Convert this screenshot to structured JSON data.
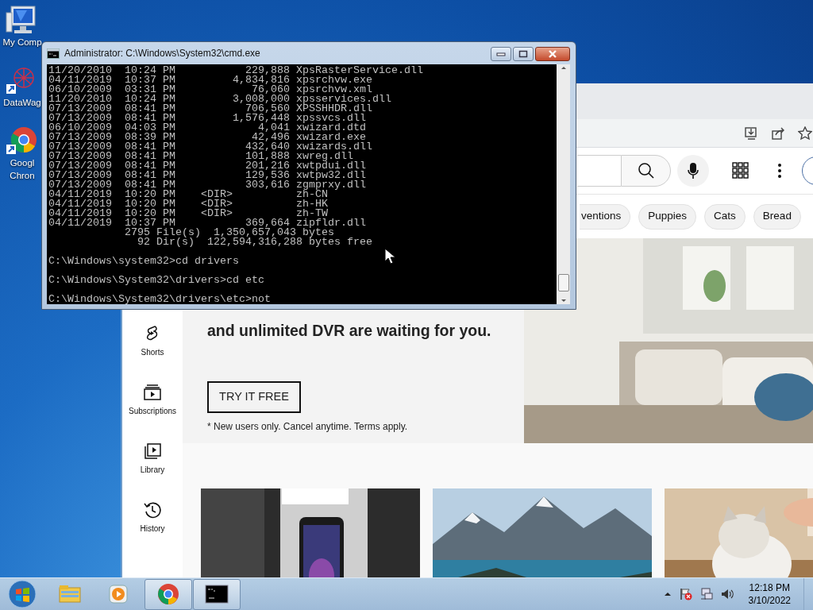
{
  "desktop_icons": [
    {
      "kind": "computer",
      "lines": [
        "My Comp"
      ]
    },
    {
      "kind": "app",
      "lines": [
        "DataWag"
      ]
    },
    {
      "kind": "browser",
      "lines": [
        "Googl",
        "Chron"
      ]
    }
  ],
  "browser": {
    "chips": [
      {
        "label": "ventions",
        "selected": false
      },
      {
        "label": "Puppies",
        "selected": false
      },
      {
        "label": "Cats",
        "selected": false
      },
      {
        "label": "Bread",
        "selected": false
      }
    ],
    "sidebar": [
      {
        "kind": "shorts",
        "label": "Shorts"
      },
      {
        "kind": "subscriptions",
        "label": "Subscriptions"
      },
      {
        "kind": "library",
        "label": "Library"
      },
      {
        "kind": "history",
        "label": "History"
      }
    ],
    "ad": {
      "heading": "and unlimited DVR are waiting for you.",
      "button": "TRY IT FREE",
      "note": "* New users only. Cancel anytime. Terms apply."
    }
  },
  "cmd": {
    "title": "Administrator: C:\\Windows\\System32\\cmd.exe",
    "lines": [
      "11/20/2010  10:24 PM           229,888 XpsRasterService.dll",
      "04/11/2019  10:37 PM         4,834,816 xpsrchvw.exe",
      "06/10/2009  03:31 PM            76,060 xpsrchvw.xml",
      "11/20/2010  10:24 PM         3,008,000 xpsservices.dll",
      "07/13/2009  08:41 PM           706,560 XPSSHHDR.dll",
      "07/13/2009  08:41 PM         1,576,448 xpssvcs.dll",
      "06/10/2009  04:03 PM             4,041 xwizard.dtd",
      "07/13/2009  08:39 PM            42,496 xwizard.exe",
      "07/13/2009  08:41 PM           432,640 xwizards.dll",
      "07/13/2009  08:41 PM           101,888 xwreg.dll",
      "07/13/2009  08:41 PM           201,216 xwtpdui.dll",
      "07/13/2009  08:41 PM           129,536 xwtpw32.dll",
      "07/13/2009  08:41 PM           303,616 zgmprxy.dll",
      "04/11/2019  10:20 PM    <DIR>          zh-CN",
      "04/11/2019  10:20 PM    <DIR>          zh-HK",
      "04/11/2019  10:20 PM    <DIR>          zh-TW",
      "04/11/2019  10:37 PM           369,664 zipfldr.dll",
      "            2795 File(s)  1,350,657,043 bytes",
      "              92 Dir(s)  122,594,316,288 bytes free"
    ],
    "prompts": [
      {
        "text": "C:\\Windows\\system32>cd drivers",
        "blank_before": true
      },
      {
        "text": "C:\\Windows\\System32\\drivers>cd etc",
        "blank_before": true
      },
      {
        "text": "C:\\Windows\\System32\\drivers\\etc>not",
        "blank_before": true
      }
    ]
  },
  "taskbar": {
    "buttons": [
      {
        "kind": "explorer",
        "active": false
      },
      {
        "kind": "media",
        "active": false
      },
      {
        "kind": "chrome",
        "active": true
      },
      {
        "kind": "console",
        "active": true
      }
    ],
    "time": "12:18 PM",
    "date": "3/10/2022"
  }
}
